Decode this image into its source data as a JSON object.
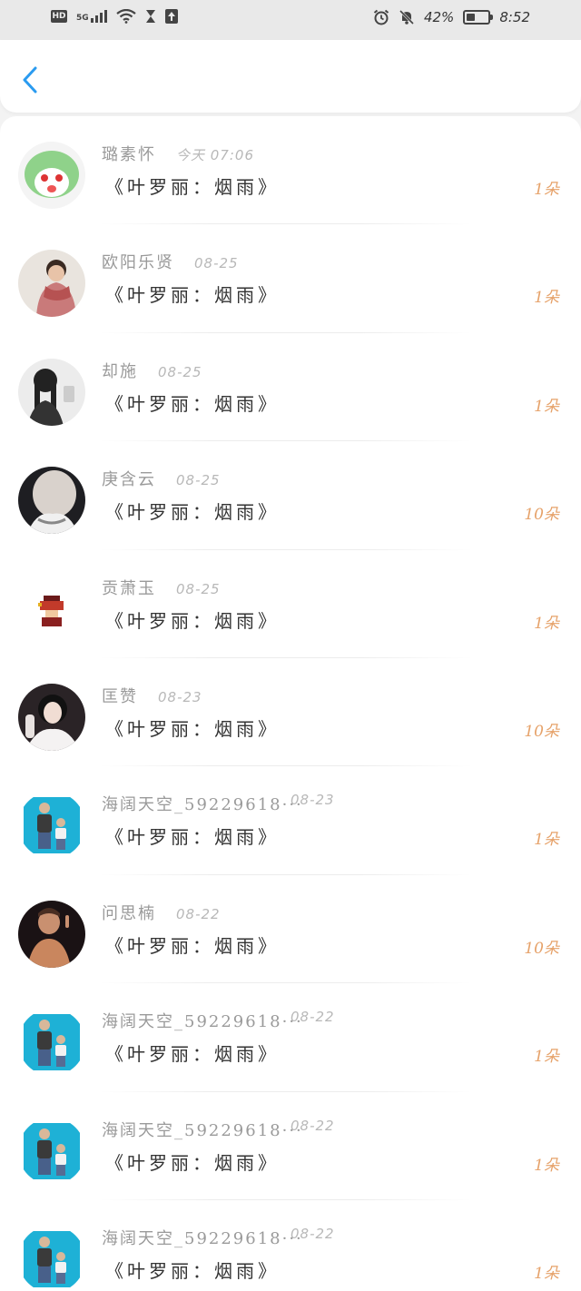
{
  "status_bar": {
    "network": "5G",
    "hd_badge": "HD",
    "battery_text": "42%",
    "battery_level": 0.42,
    "time": "8:52"
  },
  "header": {
    "back_icon": "chevron-left-icon",
    "accent_color": "#2a9bf0"
  },
  "rows": [
    {
      "name": "璐素怀",
      "time": "今天 07:06",
      "gift": "《叶罗丽：烟雨》",
      "count": "1朵",
      "avatar": "green-cartoon"
    },
    {
      "name": "欧阳乐贤",
      "time": "08-25",
      "gift": "《叶罗丽：烟雨》",
      "count": "1朵",
      "avatar": "person-scarf"
    },
    {
      "name": "却施",
      "time": "08-25",
      "gift": "《叶罗丽：烟雨》",
      "count": "1朵",
      "avatar": "girl-braids"
    },
    {
      "name": "庚含云",
      "time": "08-25",
      "gift": "《叶罗丽：烟雨》",
      "count": "10朵",
      "avatar": "face-closeup"
    },
    {
      "name": "贡萧玉",
      "time": "08-25",
      "gift": "《叶罗丽：烟雨》",
      "count": "1朵",
      "avatar": "pixel-character"
    },
    {
      "name": "匡赞",
      "time": "08-23",
      "gift": "《叶罗丽：烟雨》",
      "count": "10朵",
      "avatar": "girl-portrait"
    },
    {
      "name": "海阔天空_59229618···",
      "time": "08-23",
      "gift": "《叶罗丽：烟雨》",
      "count": "1朵",
      "avatar": "man-and-child"
    },
    {
      "name": "问思楠",
      "time": "08-22",
      "gift": "《叶罗丽：烟雨》",
      "count": "10朵",
      "avatar": "man-dark"
    },
    {
      "name": "海阔天空_59229618···",
      "time": "08-22",
      "gift": "《叶罗丽：烟雨》",
      "count": "1朵",
      "avatar": "man-and-child"
    },
    {
      "name": "海阔天空_59229618···",
      "time": "08-22",
      "gift": "《叶罗丽：烟雨》",
      "count": "1朵",
      "avatar": "man-and-child"
    },
    {
      "name": "海阔天空_59229618···",
      "time": "08-22",
      "gift": "《叶罗丽：烟雨》",
      "count": "1朵",
      "avatar": "man-and-child"
    }
  ],
  "colors": {
    "count": "#e6a26a",
    "name": "#9a9a9a",
    "time": "#b8b8b8"
  }
}
